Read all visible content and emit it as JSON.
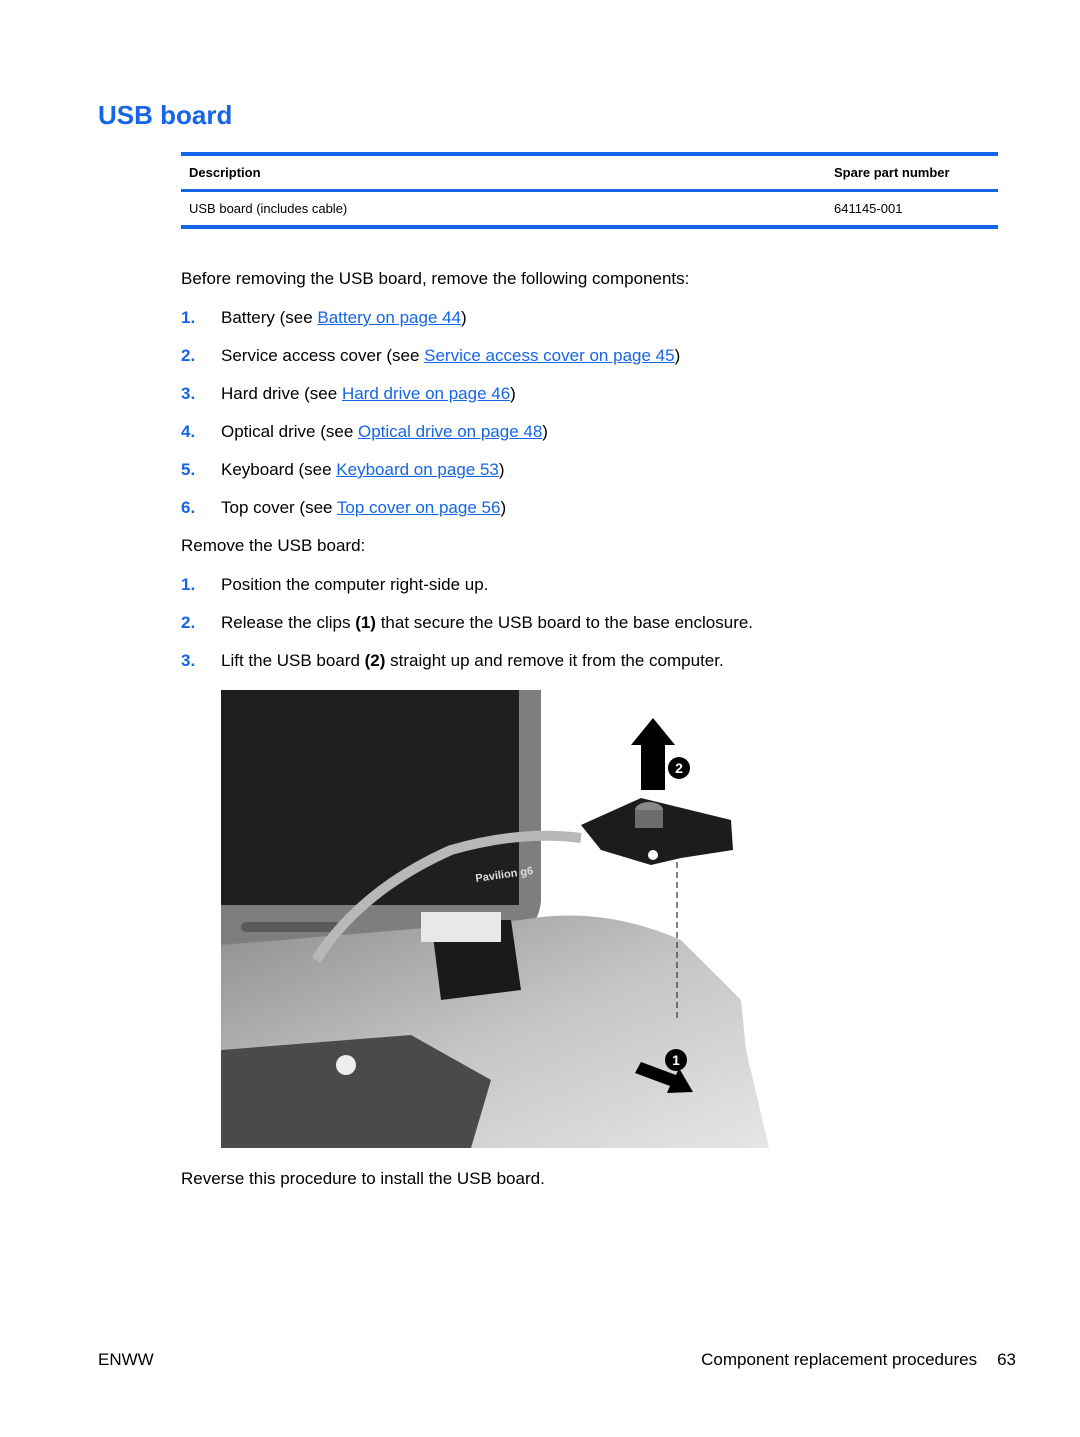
{
  "page": {
    "title": "USB board",
    "accent_color": "#1565e8"
  },
  "parts_table": {
    "headers": [
      "Description",
      "Spare part number"
    ],
    "rows": [
      [
        "USB board (includes cable)",
        "641145-001"
      ]
    ]
  },
  "prereq": {
    "intro": "Before removing the USB board, remove the following components:",
    "items": [
      {
        "num": "1.",
        "prefix": "Battery (see ",
        "link": "Battery on page 44",
        "suffix": ")"
      },
      {
        "num": "2.",
        "prefix": "Service access cover (see ",
        "link": "Service access cover on page 45",
        "suffix": ")"
      },
      {
        "num": "3.",
        "prefix": "Hard drive (see ",
        "link": "Hard drive on page 46",
        "suffix": ")"
      },
      {
        "num": "4.",
        "prefix": "Optical drive (see ",
        "link": "Optical drive on page 48",
        "suffix": ")"
      },
      {
        "num": "5.",
        "prefix": "Keyboard (see ",
        "link": "Keyboard on page 53",
        "suffix": ")"
      },
      {
        "num": "6.",
        "prefix": "Top cover (see ",
        "link": "Top cover on page 56",
        "suffix": ")"
      }
    ]
  },
  "removal": {
    "intro": "Remove the USB board:",
    "steps": [
      {
        "num": "1.",
        "before": "Position the computer right-side up.",
        "bold": "",
        "after": ""
      },
      {
        "num": "2.",
        "before": "Release the clips ",
        "bold": "(1)",
        "after": " that secure the USB board to the base enclosure."
      },
      {
        "num": "3.",
        "before": "Lift the USB board ",
        "bold": "(2)",
        "after": " straight up and remove it from the computer."
      }
    ]
  },
  "figure": {
    "callout_1": "1",
    "callout_2": "2",
    "brand_text": "Pavilion g6"
  },
  "closing": "Reverse this procedure to install the USB board.",
  "footer": {
    "left": "ENWW",
    "section": "Component replacement procedures",
    "page_number": "63"
  }
}
